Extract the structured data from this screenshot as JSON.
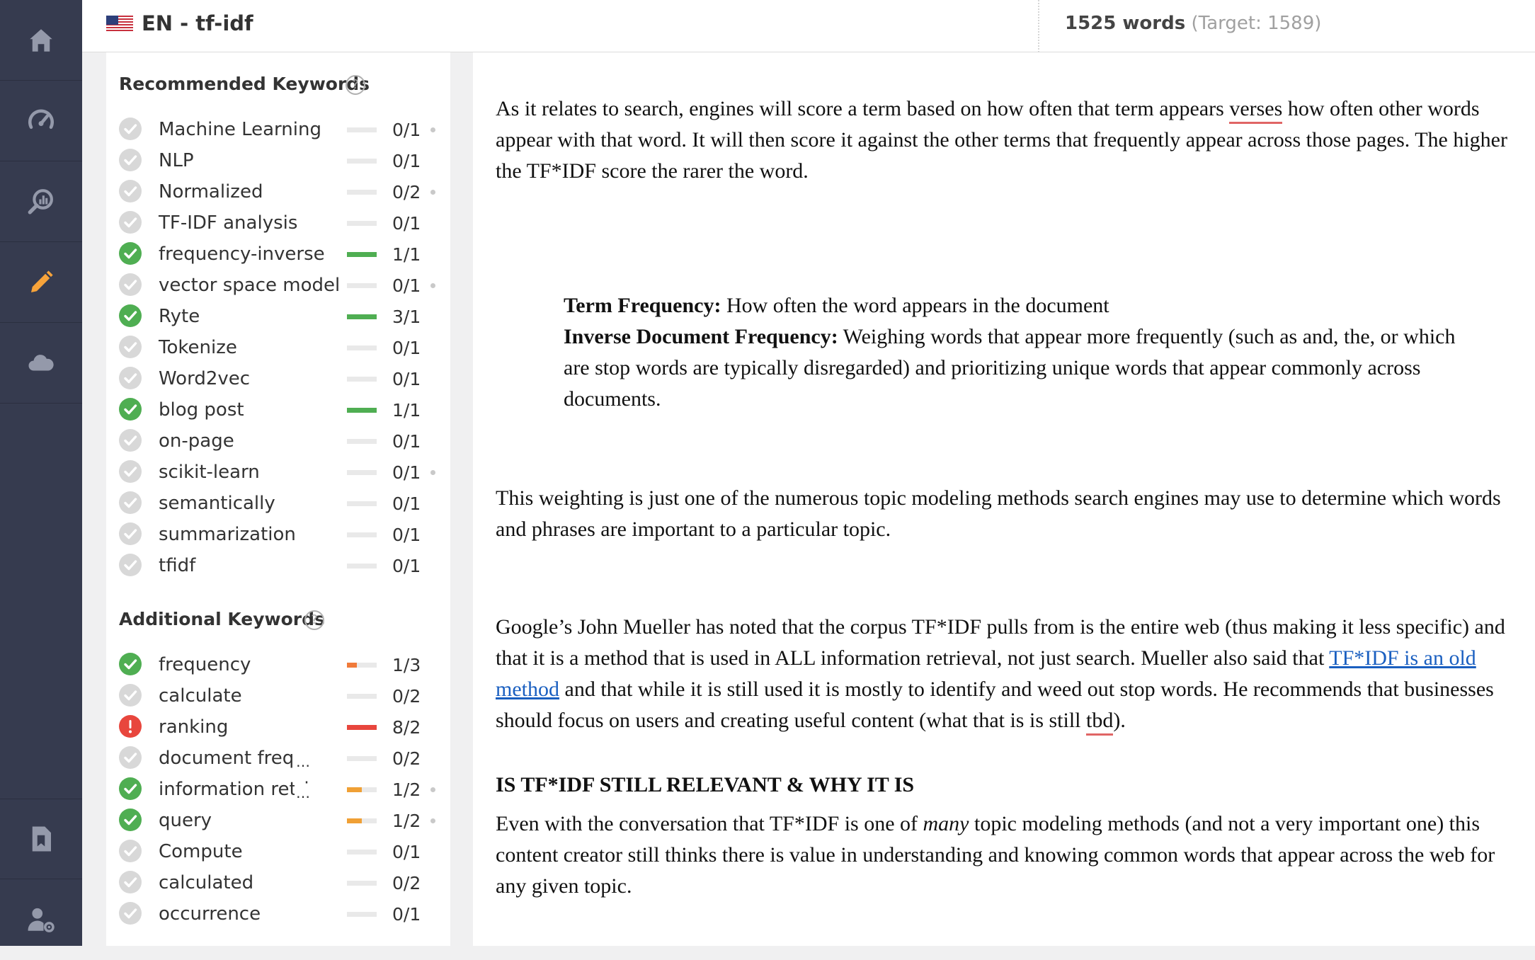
{
  "header": {
    "doc_title": "EN - tf-idf",
    "word_count": "1525 words",
    "target": "(Target: 1589)"
  },
  "nav": {
    "items": [
      "home-icon",
      "speedometer-icon",
      "analytics-search-icon",
      "pencil-icon",
      "cloud-icon",
      "document-bookmark-icon",
      "user-settings-icon"
    ],
    "active": "pencil-icon"
  },
  "colors": {
    "green": "#4fae52",
    "red": "#e8463d",
    "orange": "#f0a035",
    "sidebar": "#363b4f",
    "accent_active": "#f7a33a"
  },
  "recommended": {
    "title": "Recommended Keywords",
    "items": [
      {
        "label": "Machine Learning",
        "count": "0/1",
        "status": "none",
        "fill": 0,
        "dot": true
      },
      {
        "label": "NLP",
        "count": "0/1",
        "status": "none",
        "fill": 0,
        "dot": false
      },
      {
        "label": "Normalized",
        "count": "0/2",
        "status": "none",
        "fill": 0,
        "dot": true
      },
      {
        "label": "TF-IDF analysis",
        "count": "0/1",
        "status": "none",
        "fill": 0,
        "dot": false
      },
      {
        "label": "frequency-inverse",
        "count": "1/1",
        "status": "ok",
        "fill": 1,
        "color": "#4fae52",
        "dot": false
      },
      {
        "label": "vector space model",
        "count": "0/1",
        "status": "none",
        "fill": 0,
        "dot": true
      },
      {
        "label": "Ryte",
        "count": "3/1",
        "status": "ok",
        "fill": 1,
        "color": "#4fae52",
        "dot": false
      },
      {
        "label": "Tokenize",
        "count": "0/1",
        "status": "none",
        "fill": 0,
        "dot": false
      },
      {
        "label": "Word2vec",
        "count": "0/1",
        "status": "none",
        "fill": 0,
        "dot": false
      },
      {
        "label": "blog post",
        "count": "1/1",
        "status": "ok",
        "fill": 1,
        "color": "#4fae52",
        "dot": false
      },
      {
        "label": "on-page",
        "count": "0/1",
        "status": "none",
        "fill": 0,
        "dot": false
      },
      {
        "label": "scikit-learn",
        "count": "0/1",
        "status": "none",
        "fill": 0,
        "dot": true
      },
      {
        "label": "semantically",
        "count": "0/1",
        "status": "none",
        "fill": 0,
        "dot": false
      },
      {
        "label": "summarization",
        "count": "0/1",
        "status": "none",
        "fill": 0,
        "dot": false
      },
      {
        "label": "tfidf",
        "count": "0/1",
        "status": "none",
        "fill": 0,
        "dot": false
      }
    ]
  },
  "additional": {
    "title": "Additional Keywords",
    "items": [
      {
        "label": "frequency",
        "count": "1/3",
        "status": "ok",
        "fill": 0.33,
        "color": "#f07a3a",
        "dot": false,
        "trunc": false
      },
      {
        "label": "calculate",
        "count": "0/2",
        "status": "none",
        "fill": 0,
        "dot": false,
        "trunc": false
      },
      {
        "label": "ranking",
        "count": "8/2",
        "status": "err",
        "fill": 1,
        "color": "#e8463d",
        "dot": false,
        "trunc": false
      },
      {
        "label": "document frequency",
        "count": "0/2",
        "status": "none",
        "fill": 0,
        "dot": false,
        "trunc": true
      },
      {
        "label": "information retrieval",
        "count": "1/2",
        "status": "ok",
        "fill": 0.5,
        "color": "#f0a035",
        "dot": true,
        "trunc": true
      },
      {
        "label": "query",
        "count": "1/2",
        "status": "ok",
        "fill": 0.5,
        "color": "#f0a035",
        "dot": true,
        "trunc": false
      },
      {
        "label": "Compute",
        "count": "0/1",
        "status": "none",
        "fill": 0,
        "dot": false,
        "trunc": false
      },
      {
        "label": "calculated",
        "count": "0/2",
        "status": "none",
        "fill": 0,
        "dot": false,
        "trunc": false
      },
      {
        "label": "occurrence",
        "count": "0/1",
        "status": "none",
        "fill": 0,
        "dot": false,
        "trunc": false
      }
    ]
  },
  "content": {
    "p1a": "As it relates to search, engines will score a term based on how often that term appears ",
    "p1_squig": "verses",
    "p1b": " how often other words appear with that word.  It will then score it against the other terms that frequently appear across those pages. The higher the TF*IDF score the rarer the word.",
    "tf_label": "Term Frequency:",
    "tf_text": " How often the word appears in the document",
    "idf_label": "Inverse Document Frequency:",
    "idf_text": " Weighing words that appear more frequently (such as and, the, or which are stop words are typically disregarded) and prioritizing unique words that appear commonly across documents.",
    "p2": "This weighting is just one of the numerous topic modeling methods search engines may use to determine which words and phrases are important to a particular topic.",
    "p3a": "Google’s John Mueller has noted that the corpus TF*IDF pulls from is the entire web (thus making it less specific) and that it is a method that is used in ALL information retrieval, not just search. Mueller also said that ",
    "p3_link": "TF*IDF is an old method",
    "p3b": " and that while it is still used it is mostly to identify and weed out stop words. He recommends that businesses should focus on users and creating useful content (what that is is still ",
    "p3_squig": "tbd",
    "p3c": ").",
    "heading": "IS TF*IDF STILL RELEVANT & WHY IT IS",
    "p4a": "Even with the conversation that TF*IDF is one of ",
    "p4_em": "many",
    "p4b": " topic modeling methods (and not a very important one) this content creator still thinks there is value in understanding and knowing common words that appear across the web for any given topic."
  }
}
